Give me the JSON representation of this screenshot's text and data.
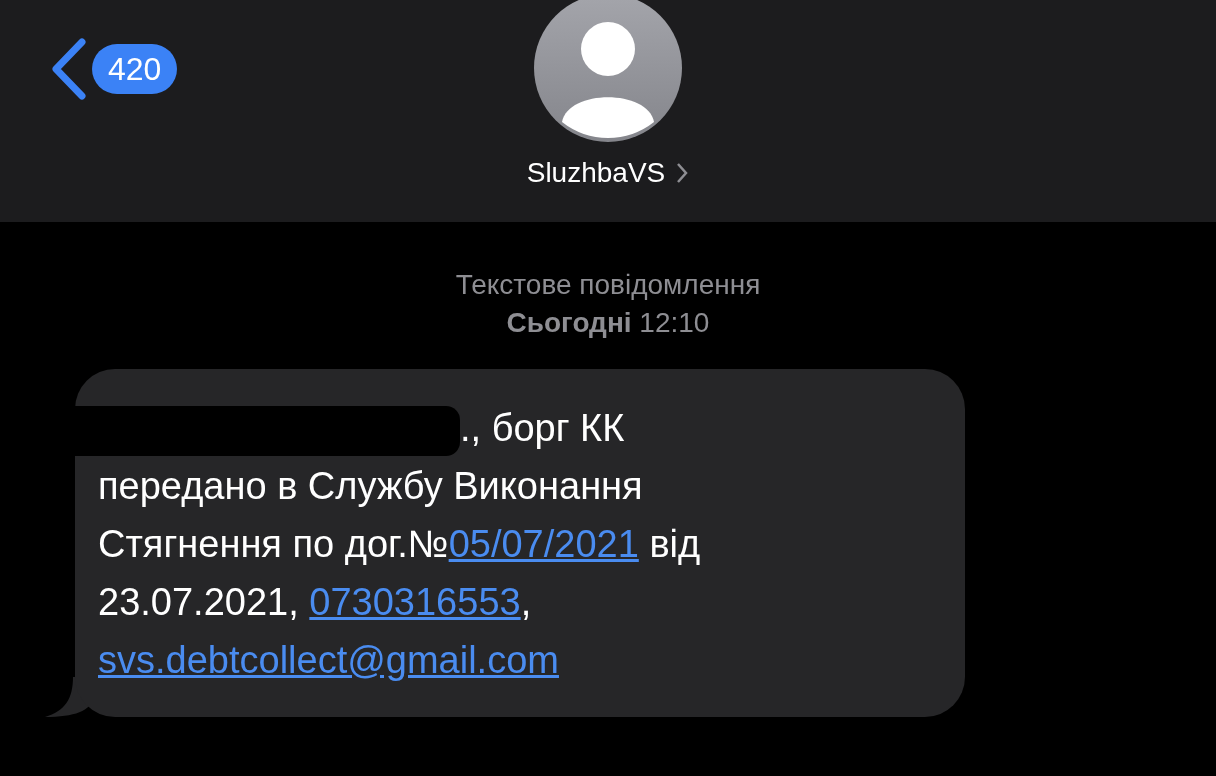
{
  "header": {
    "back_badge": "420",
    "contact_name": "SluzhbaVS"
  },
  "thread": {
    "label": "Текстове повідомлення",
    "day": "Сьогодні",
    "time": "12:10"
  },
  "message": {
    "parts": [
      {
        "kind": "text",
        "text": "., борг КК\nпередано в Службу Виконання\nСтягнення по дог.№"
      },
      {
        "kind": "link",
        "text": "05/07/2021"
      },
      {
        "kind": "text",
        "text": " від\n23.07.2021, "
      },
      {
        "kind": "link",
        "text": "0730316553"
      },
      {
        "kind": "text",
        "text": ",\n"
      },
      {
        "kind": "link",
        "text": "svs.debtcollect@gmail.com"
      }
    ]
  }
}
